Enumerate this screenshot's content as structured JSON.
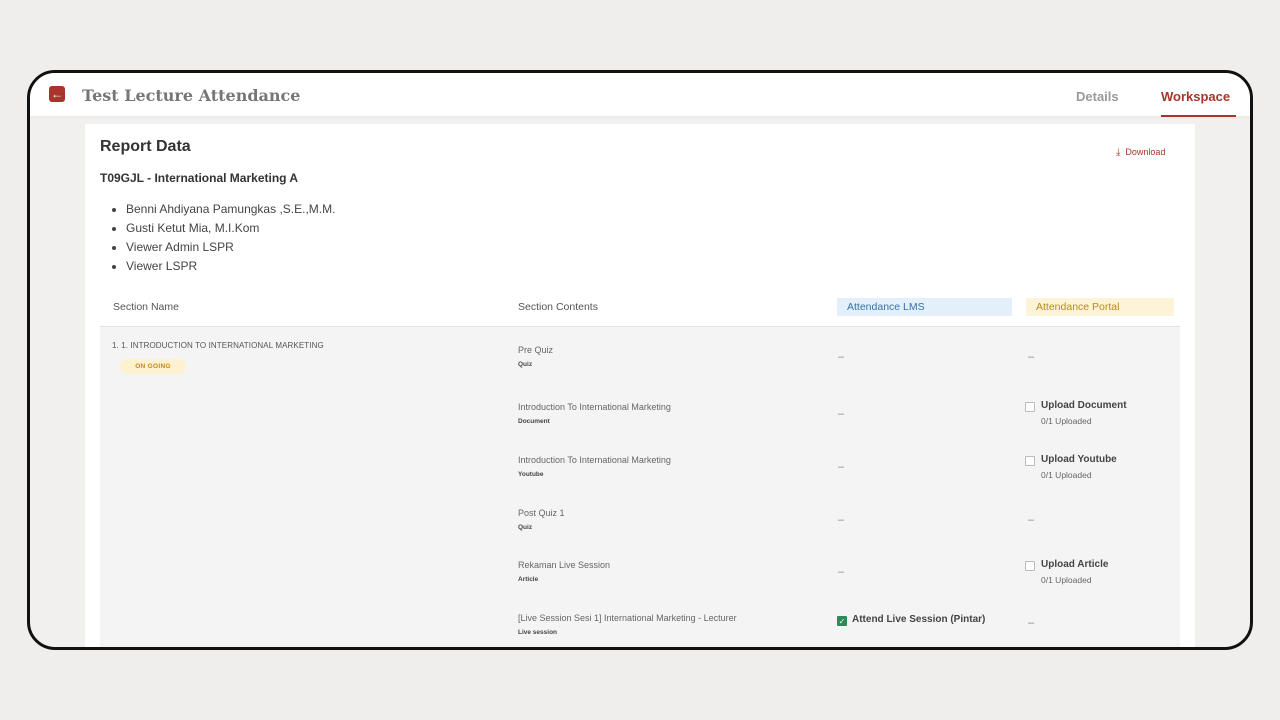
{
  "header": {
    "title": "Test Lecture Attendance",
    "back_icon": "arrow-left-icon",
    "tabs": [
      {
        "label": "Details",
        "active": false
      },
      {
        "label": "Workspace",
        "active": true
      }
    ],
    "accent_color": "#a8352b"
  },
  "report": {
    "title": "Report Data",
    "download_label": "Download",
    "download_icon": "download-icon",
    "course": "T09GJL - International Marketing A",
    "lecturers": [
      "Benni Ahdiyana Pamungkas ,S.E.,M.M.",
      "Gusti Ketut Mia, M.I.Kom",
      "Viewer Admin LSPR",
      "Viewer LSPR"
    ]
  },
  "table": {
    "columns": {
      "section_name": "Section Name",
      "section_contents": "Section Contents",
      "attendance_lms": "Attendance LMS",
      "attendance_portal": "Attendance Portal"
    },
    "section": {
      "name": "1. 1. INTRODUCTION TO INTERNATIONAL MARKETING",
      "status": "ON GOING"
    },
    "rows": [
      {
        "title": "Pre Quiz",
        "type": "Quiz",
        "lms": "–",
        "portal": "–"
      },
      {
        "title": "Introduction To International Marketing",
        "type": "Document",
        "lms": "–",
        "portal_title": "Upload Document",
        "portal_sub": "0/1 Uploaded"
      },
      {
        "title": "Introduction To International Marketing",
        "type": "Youtube",
        "lms": "–",
        "portal_title": "Upload Youtube",
        "portal_sub": "0/1 Uploaded"
      },
      {
        "title": "Post Quiz 1",
        "type": "Quiz",
        "lms": "–",
        "portal": "–"
      },
      {
        "title": "Rekaman Live Session",
        "type": "Article",
        "lms": "–",
        "portal_title": "Upload Article",
        "portal_sub": "0/1 Uploaded"
      },
      {
        "title": "[Live Session Sesi 1] International Marketing - Lecturer",
        "type": "Live session",
        "lms_label": "Attend Live Session (Pintar)",
        "lms_checked": true,
        "portal": "–"
      }
    ]
  }
}
